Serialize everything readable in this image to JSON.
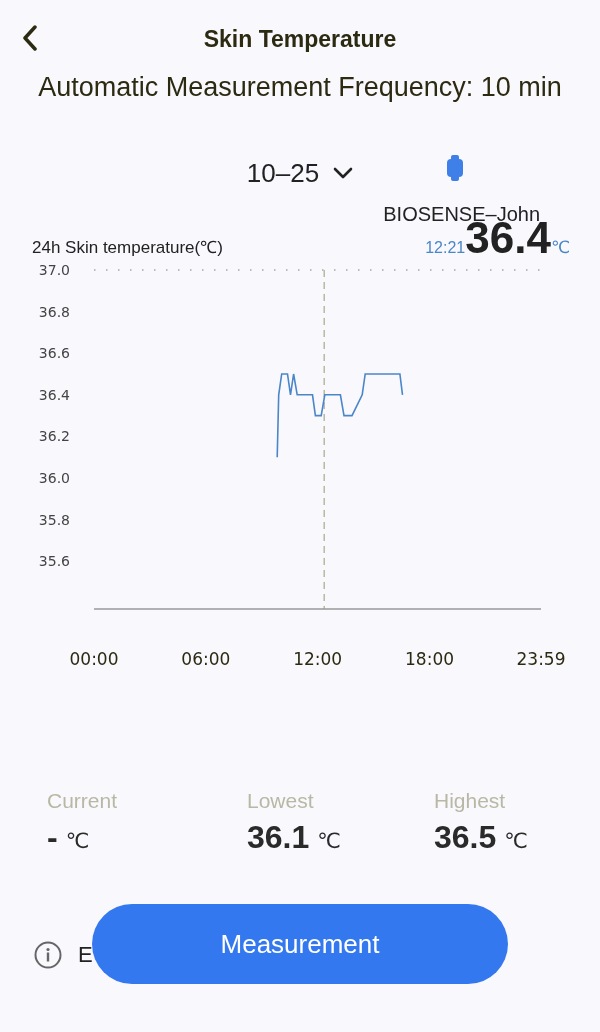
{
  "header": {
    "title": "Skin Temperature"
  },
  "subtitle": "Automatic Measurement Frequency: 10 min",
  "date_selector": {
    "value": "10–25"
  },
  "device": {
    "name": "BIOSENSE–John"
  },
  "chart_panel": {
    "title": "24h Skin temperature(℃)",
    "readout_time": "12:21",
    "readout_value": "36.4",
    "readout_unit": "℃",
    "chart_data": {
      "type": "line",
      "x": [
        9.83,
        9.91,
        10.07,
        10.38,
        10.54,
        10.71,
        10.9,
        11.72,
        11.88,
        12.19,
        12.38,
        13.22,
        13.41,
        13.84,
        14.39,
        14.55,
        16.41,
        16.55
      ],
      "series": [
        {
          "color": "#4a86c8",
          "values": [
            36.1,
            36.4,
            36.5,
            36.5,
            36.4,
            36.5,
            36.4,
            36.4,
            36.3,
            36.3,
            36.4,
            36.4,
            36.3,
            36.3,
            36.4,
            36.5,
            36.5,
            36.4
          ]
        }
      ],
      "xlim": [
        0,
        23.98
      ],
      "ylim": [
        35.37,
        37.0
      ],
      "xticks": [
        {
          "value": 0,
          "label": "00:00"
        },
        {
          "value": 6,
          "label": "06:00"
        },
        {
          "value": 12,
          "label": "12:00"
        },
        {
          "value": 18,
          "label": "18:00"
        },
        {
          "value": 23.98,
          "label": "23:59"
        }
      ],
      "yticks": [
        {
          "value": 37,
          "label": "37.0"
        },
        {
          "value": 36.8,
          "label": "36.8"
        },
        {
          "value": 36.6,
          "label": "36.6"
        },
        {
          "value": 36.4,
          "label": "36.4"
        },
        {
          "value": 36.2,
          "label": "36.2"
        },
        {
          "value": 36,
          "label": "36.0"
        },
        {
          "value": 35.8,
          "label": "35.8"
        },
        {
          "value": 35.6,
          "label": "35.6"
        }
      ],
      "ref_lines": [
        {
          "axis": "x",
          "value": 12.35
        }
      ]
    }
  },
  "stats": [
    {
      "label": "Current",
      "value": "-",
      "unit": "℃"
    },
    {
      "label": "Lowest",
      "value": "36.1",
      "unit": "℃"
    },
    {
      "label": "Highest",
      "value": "36.5",
      "unit": "℃"
    }
  ],
  "info": {
    "text": "E"
  },
  "measure_button": {
    "label": "Measurement"
  }
}
